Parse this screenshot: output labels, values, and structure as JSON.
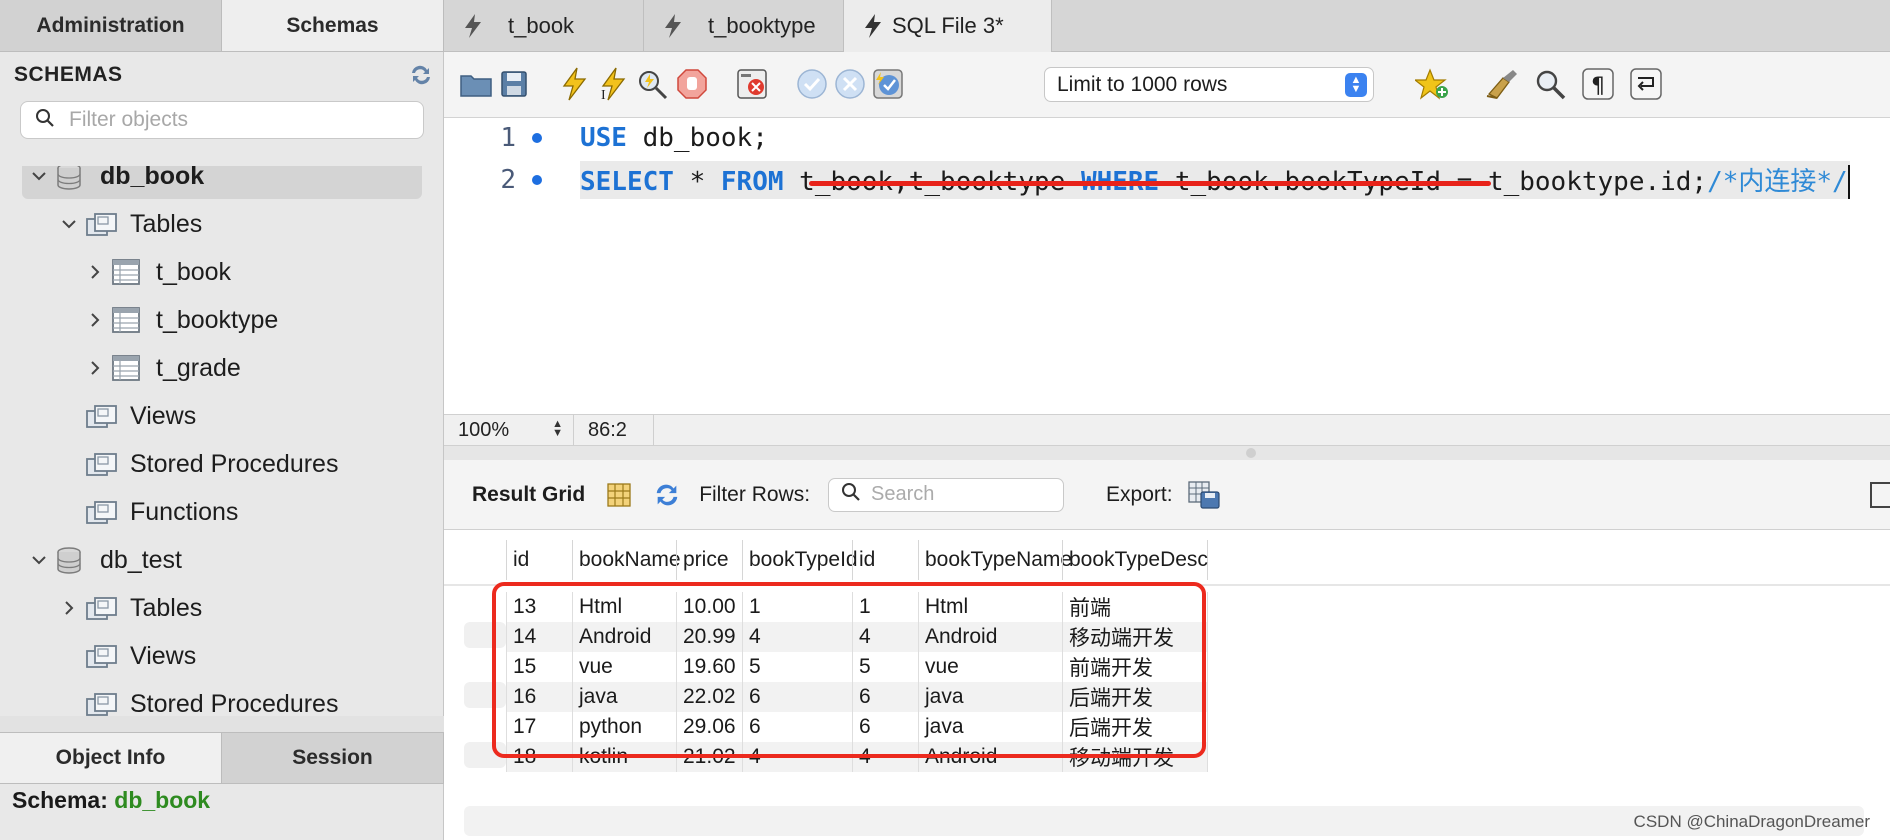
{
  "sidebar": {
    "tabs": [
      {
        "label": "Administration"
      },
      {
        "label": "Schemas"
      }
    ],
    "header": "SCHEMAS",
    "filter_placeholder": "Filter objects",
    "tree": [
      {
        "label": "db_book",
        "bold": true,
        "chev": "v",
        "icon": "db"
      },
      {
        "label": "Tables",
        "chev": "v",
        "icon": "folder"
      },
      {
        "label": "t_book",
        "chev": ">",
        "icon": "table"
      },
      {
        "label": "t_booktype",
        "chev": ">",
        "icon": "table"
      },
      {
        "label": "t_grade",
        "chev": ">",
        "icon": "table"
      },
      {
        "label": "Views",
        "chev": "",
        "icon": "folder"
      },
      {
        "label": "Stored Procedures",
        "chev": "",
        "icon": "folder"
      },
      {
        "label": "Functions",
        "chev": "",
        "icon": "folder"
      },
      {
        "label": "db_test",
        "bold": false,
        "chev": "v",
        "icon": "db"
      },
      {
        "label": "Tables",
        "chev": ">",
        "icon": "folder"
      },
      {
        "label": "Views",
        "chev": "",
        "icon": "folder"
      },
      {
        "label": "Stored Procedures",
        "chev": "",
        "icon": "folder"
      }
    ],
    "bottom_tabs": [
      {
        "label": "Object Info"
      },
      {
        "label": "Session"
      }
    ],
    "schema_label": "Schema:",
    "schema_value": "db_book"
  },
  "file_tabs": [
    {
      "label": "t_book"
    },
    {
      "label": "t_booktype"
    },
    {
      "label": "SQL File 3*"
    }
  ],
  "toolbar": {
    "limit_label": "Limit to 1000 rows"
  },
  "editor": {
    "lines": [
      {
        "num": "1",
        "parts": [
          {
            "t": "kw",
            "v": "USE"
          },
          {
            "t": "txt",
            "v": " db_book;"
          }
        ]
      },
      {
        "num": "2",
        "parts": [
          {
            "t": "kw",
            "v": "SELECT"
          },
          {
            "t": "txt",
            "v": " * "
          },
          {
            "t": "kw",
            "v": "FROM"
          },
          {
            "t": "txt",
            "v": " t_book,t_booktype "
          },
          {
            "t": "kw",
            "v": "WHERE"
          },
          {
            "t": "txt",
            "v": " t_book.bookTypeId = t_booktype.id;"
          },
          {
            "t": "cmt",
            "v": "/*内连接*/"
          }
        ]
      }
    ]
  },
  "status": {
    "zoom": "100%",
    "position": "86:2"
  },
  "result": {
    "title": "Result Grid",
    "filter_label": "Filter Rows:",
    "search_placeholder": "Search",
    "export_label": "Export:",
    "columns": [
      "id",
      "bookName",
      "price",
      "bookTypeId",
      "id",
      "bookTypeName",
      "bookTypeDesc"
    ],
    "rows": [
      [
        "13",
        "Html",
        "10.00",
        "1",
        "1",
        "Html",
        "前端"
      ],
      [
        "14",
        "Android",
        "20.99",
        "4",
        "4",
        "Android",
        "移动端开发"
      ],
      [
        "15",
        "vue",
        "19.60",
        "5",
        "5",
        "vue",
        "前端开发"
      ],
      [
        "16",
        "java",
        "22.02",
        "6",
        "6",
        "java",
        "后端开发"
      ],
      [
        "17",
        "python",
        "29.06",
        "6",
        "6",
        "java",
        "后端开发"
      ],
      [
        "18",
        "kotlin",
        "21.02",
        "4",
        "4",
        "Android",
        "移动端开发"
      ]
    ]
  },
  "watermark": "CSDN @ChinaDragonDreamer",
  "colors": {
    "keyword": "#1d72d4",
    "comment": "#2f8ad6",
    "annotation": "#ec2a1e",
    "schema_value": "#2e8b20"
  }
}
